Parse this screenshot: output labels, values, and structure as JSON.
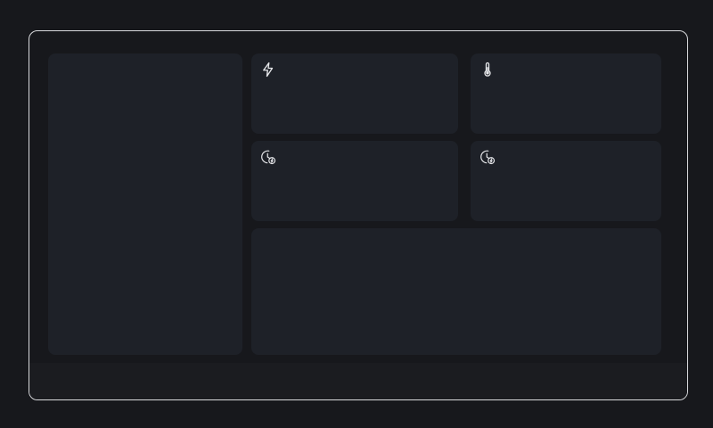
{
  "dashboard": {
    "cards": [
      {
        "name": "sidebar-panel"
      },
      {
        "name": "power-card",
        "icon": "lightning-icon"
      },
      {
        "name": "temperature-card",
        "icon": "thermometer-icon"
      },
      {
        "name": "energy-timer-card-1",
        "icon": "clock-energy-icon"
      },
      {
        "name": "energy-timer-card-2",
        "icon": "clock-energy-icon"
      },
      {
        "name": "chart-panel"
      }
    ]
  },
  "colors": {
    "background": "#17181c",
    "card": "#1e2128",
    "border": "#d9dadd",
    "icon": "#e6e7ea"
  }
}
